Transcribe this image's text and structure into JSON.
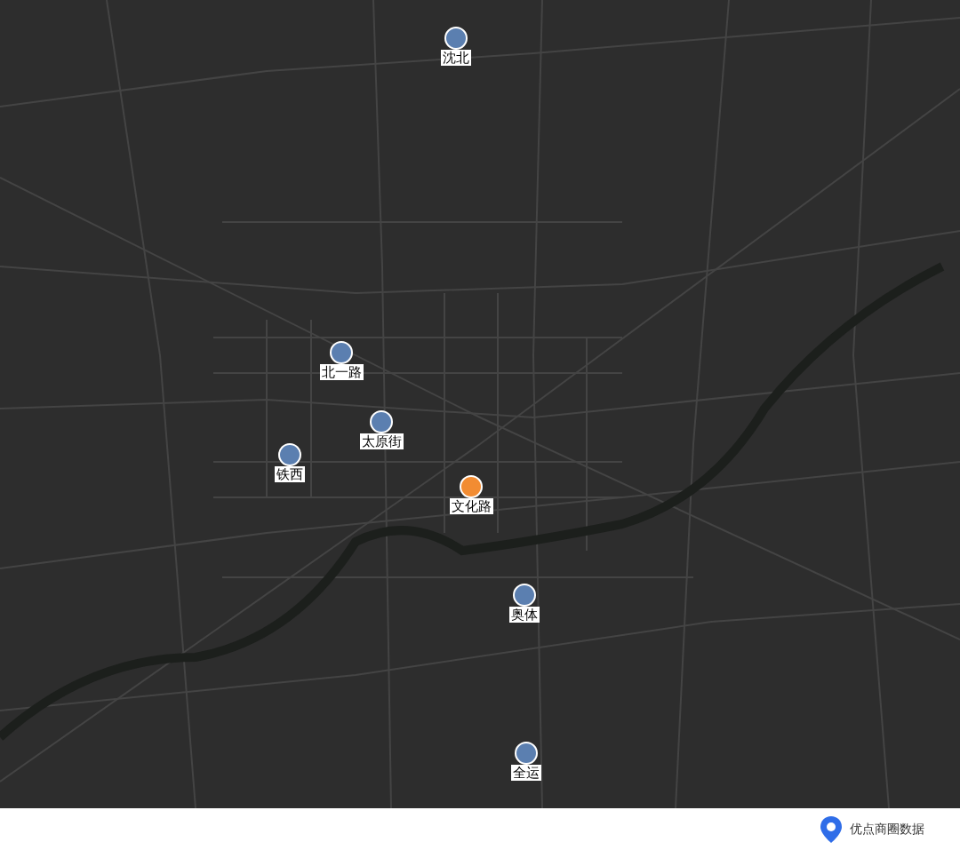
{
  "map": {
    "markers": [
      {
        "label": "沈北",
        "color": "#5b7fb0"
      },
      {
        "label": "北一路",
        "color": "#5b7fb0"
      },
      {
        "label": "太原街",
        "color": "#5b7fb0"
      },
      {
        "label": "铁西",
        "color": "#5b7fb0"
      },
      {
        "label": "文化路",
        "color": "#f28c32"
      },
      {
        "label": "奥体",
        "color": "#5b7fb0"
      },
      {
        "label": "全运",
        "color": "#5b7fb0"
      }
    ]
  },
  "footer": {
    "brand": "优点商圈数据"
  }
}
